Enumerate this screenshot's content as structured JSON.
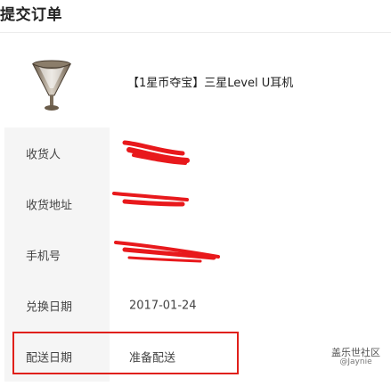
{
  "header": {
    "title": "提交订单"
  },
  "product": {
    "name": "【1星币夺宝】三星Level U耳机",
    "icon": "trophy-cup-icon"
  },
  "fields": [
    {
      "label": "收货人",
      "value": ""
    },
    {
      "label": "收货地址",
      "value": ""
    },
    {
      "label": "手机号",
      "value": ""
    },
    {
      "label": "兑换日期",
      "value": "2017-01-24"
    },
    {
      "label": "配送日期",
      "value": "准备配送"
    }
  ],
  "watermark": {
    "main": "盖乐世社区",
    "sub": "@Jaynie"
  },
  "colors": {
    "highlight": "#e0201a",
    "redaction": "#e8191c",
    "label_bg": "#f5f5f5"
  }
}
